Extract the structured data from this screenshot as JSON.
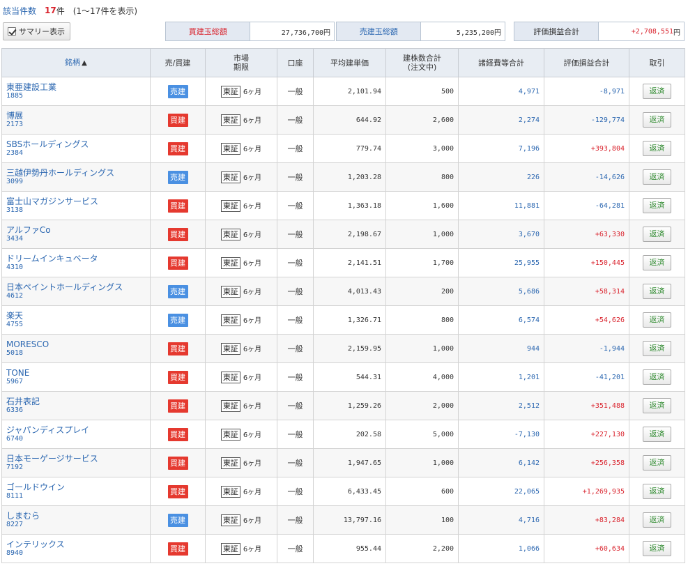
{
  "summary": {
    "count_label": "該当件数",
    "count": "17",
    "count_unit": "件",
    "range_text": "(1～17件を表示)",
    "summary_toggle_label": "サマリー表示",
    "buy_total_label": "買建玉総額",
    "buy_total_value": "27,736,700円",
    "sell_total_label": "売建玉総額",
    "sell_total_value": "5,235,200円",
    "pl_total_label": "評価損益合計",
    "pl_total_value": "+2,708,551",
    "pl_total_unit": "円"
  },
  "table": {
    "headers": {
      "name": "銘柄",
      "sort_arrow": "▲",
      "side": "売/買建",
      "market_line1": "市場",
      "market_line2": "期限",
      "account": "口座",
      "avg_price": "平均建単価",
      "shares_line1": "建株数合計",
      "shares_line2": "(注文中)",
      "fees": "諸経費等合計",
      "pl": "評価損益合計",
      "trade": "取引"
    },
    "rows": [
      {
        "name": "東亜建設工業",
        "code": "1885",
        "side": "売建",
        "side_type": "sell",
        "market": "東証",
        "term": "6ヶ月",
        "account": "一般",
        "avg_price": "2,101.94",
        "shares": "500",
        "fees": "4,971",
        "pl": "-8,971",
        "pl_sign": "neg",
        "action": "返済"
      },
      {
        "name": "博展",
        "code": "2173",
        "side": "買建",
        "side_type": "buy",
        "market": "東証",
        "term": "6ヶ月",
        "account": "一般",
        "avg_price": "644.92",
        "shares": "2,600",
        "fees": "2,274",
        "pl": "-129,774",
        "pl_sign": "neg",
        "action": "返済"
      },
      {
        "name": "SBSホールディングス",
        "code": "2384",
        "side": "買建",
        "side_type": "buy",
        "market": "東証",
        "term": "6ヶ月",
        "account": "一般",
        "avg_price": "779.74",
        "shares": "3,000",
        "fees": "7,196",
        "pl": "+393,804",
        "pl_sign": "pos",
        "action": "返済"
      },
      {
        "name": "三越伊勢丹ホールディングス",
        "code": "3099",
        "side": "売建",
        "side_type": "sell",
        "market": "東証",
        "term": "6ヶ月",
        "account": "一般",
        "avg_price": "1,203.28",
        "shares": "800",
        "fees": "226",
        "pl": "-14,626",
        "pl_sign": "neg",
        "action": "返済"
      },
      {
        "name": "富士山マガジンサービス",
        "code": "3138",
        "side": "買建",
        "side_type": "buy",
        "market": "東証",
        "term": "6ヶ月",
        "account": "一般",
        "avg_price": "1,363.18",
        "shares": "1,600",
        "fees": "11,881",
        "pl": "-64,281",
        "pl_sign": "neg",
        "action": "返済"
      },
      {
        "name": "アルファCo",
        "code": "3434",
        "side": "買建",
        "side_type": "buy",
        "market": "東証",
        "term": "6ヶ月",
        "account": "一般",
        "avg_price": "2,198.67",
        "shares": "1,000",
        "fees": "3,670",
        "pl": "+63,330",
        "pl_sign": "pos",
        "action": "返済"
      },
      {
        "name": "ドリームインキュベータ",
        "code": "4310",
        "side": "買建",
        "side_type": "buy",
        "market": "東証",
        "term": "6ヶ月",
        "account": "一般",
        "avg_price": "2,141.51",
        "shares": "1,700",
        "fees": "25,955",
        "pl": "+150,445",
        "pl_sign": "pos",
        "action": "返済"
      },
      {
        "name": "日本ペイントホールディングス",
        "code": "4612",
        "side": "売建",
        "side_type": "sell",
        "market": "東証",
        "term": "6ヶ月",
        "account": "一般",
        "avg_price": "4,013.43",
        "shares": "200",
        "fees": "5,686",
        "pl": "+58,314",
        "pl_sign": "pos",
        "action": "返済"
      },
      {
        "name": "楽天",
        "code": "4755",
        "side": "売建",
        "side_type": "sell",
        "market": "東証",
        "term": "6ヶ月",
        "account": "一般",
        "avg_price": "1,326.71",
        "shares": "800",
        "fees": "6,574",
        "pl": "+54,626",
        "pl_sign": "pos",
        "action": "返済"
      },
      {
        "name": "MORESCO",
        "code": "5018",
        "side": "買建",
        "side_type": "buy",
        "market": "東証",
        "term": "6ヶ月",
        "account": "一般",
        "avg_price": "2,159.95",
        "shares": "1,000",
        "fees": "944",
        "pl": "-1,944",
        "pl_sign": "neg",
        "action": "返済"
      },
      {
        "name": "TONE",
        "code": "5967",
        "side": "買建",
        "side_type": "buy",
        "market": "東証",
        "term": "6ヶ月",
        "account": "一般",
        "avg_price": "544.31",
        "shares": "4,000",
        "fees": "1,201",
        "pl": "-41,201",
        "pl_sign": "neg",
        "action": "返済"
      },
      {
        "name": "石井表記",
        "code": "6336",
        "side": "買建",
        "side_type": "buy",
        "market": "東証",
        "term": "6ヶ月",
        "account": "一般",
        "avg_price": "1,259.26",
        "shares": "2,000",
        "fees": "2,512",
        "pl": "+351,488",
        "pl_sign": "pos",
        "action": "返済"
      },
      {
        "name": "ジャパンディスプレイ",
        "code": "6740",
        "side": "買建",
        "side_type": "buy",
        "market": "東証",
        "term": "6ヶ月",
        "account": "一般",
        "avg_price": "202.58",
        "shares": "5,000",
        "fees": "-7,130",
        "pl": "+227,130",
        "pl_sign": "pos",
        "action": "返済"
      },
      {
        "name": "日本モーゲージサービス",
        "code": "7192",
        "side": "買建",
        "side_type": "buy",
        "market": "東証",
        "term": "6ヶ月",
        "account": "一般",
        "avg_price": "1,947.65",
        "shares": "1,000",
        "fees": "6,142",
        "pl": "+256,358",
        "pl_sign": "pos",
        "action": "返済"
      },
      {
        "name": "ゴールドウイン",
        "code": "8111",
        "side": "買建",
        "side_type": "buy",
        "market": "東証",
        "term": "6ヶ月",
        "account": "一般",
        "avg_price": "6,433.45",
        "shares": "600",
        "fees": "22,065",
        "pl": "+1,269,935",
        "pl_sign": "pos",
        "action": "返済"
      },
      {
        "name": "しまむら",
        "code": "8227",
        "side": "売建",
        "side_type": "sell",
        "market": "東証",
        "term": "6ヶ月",
        "account": "一般",
        "avg_price": "13,797.16",
        "shares": "100",
        "fees": "4,716",
        "pl": "+83,284",
        "pl_sign": "pos",
        "action": "返済"
      },
      {
        "name": "インテリックス",
        "code": "8940",
        "side": "買建",
        "side_type": "buy",
        "market": "東証",
        "term": "6ヶ月",
        "account": "一般",
        "avg_price": "955.44",
        "shares": "2,200",
        "fees": "1,066",
        "pl": "+60,634",
        "pl_sign": "pos",
        "action": "返済"
      }
    ]
  },
  "colors": {
    "positive": "#d9232d",
    "negative": "#2a66b0",
    "buy_badge": "#e5392f",
    "sell_badge": "#4a90e2"
  }
}
